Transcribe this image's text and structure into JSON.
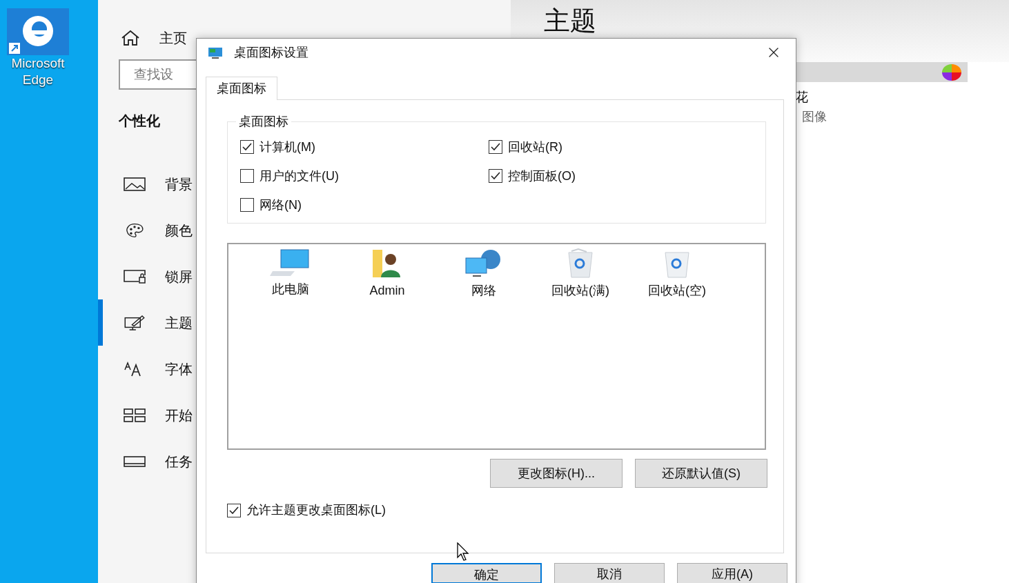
{
  "desktop": {
    "icon_label": "Microsoft Edge"
  },
  "settings": {
    "home": "主页",
    "search": {
      "placeholder": "查找设"
    },
    "section": "个性化",
    "items": [
      {
        "label": "背景",
        "selected": false
      },
      {
        "label": "颜色",
        "selected": false
      },
      {
        "label": "锁屏",
        "selected": false
      },
      {
        "label": "主题",
        "selected": true
      },
      {
        "label": "字体",
        "selected": false
      },
      {
        "label": "开始",
        "selected": false
      },
      {
        "label": "任务",
        "selected": false
      }
    ],
    "heading": "主题",
    "theme_lines": [
      "花",
      "图像"
    ]
  },
  "dialog": {
    "title": "桌面图标设置",
    "tabs": [
      {
        "label": "桌面图标",
        "selected": true
      }
    ],
    "group": {
      "legend": "桌面图标",
      "checkboxes": [
        {
          "label": "计算机(M)",
          "checked": true
        },
        {
          "label": "回收站(R)",
          "checked": true
        },
        {
          "label": "用户的文件(U)",
          "checked": false
        },
        {
          "label": "控制面板(O)",
          "checked": true
        },
        {
          "label": "网络(N)",
          "checked": false
        }
      ]
    },
    "icons": [
      {
        "label": "此电脑",
        "selected": false
      },
      {
        "label": "Admin",
        "selected": false
      },
      {
        "label": "网络",
        "selected": false
      },
      {
        "label": "回收站(满)",
        "selected": false
      },
      {
        "label": "回收站(空)",
        "selected": false
      }
    ],
    "icon_buttons": [
      "更改图标(H)...",
      "还原默认值(S)"
    ],
    "allow": {
      "label": "允许主题更改桌面图标(L)",
      "checked": true
    },
    "footer_buttons": [
      {
        "label": "确定",
        "default": true
      },
      {
        "label": "取消",
        "default": false
      },
      {
        "label": "应用(A)",
        "default": false
      }
    ]
  }
}
